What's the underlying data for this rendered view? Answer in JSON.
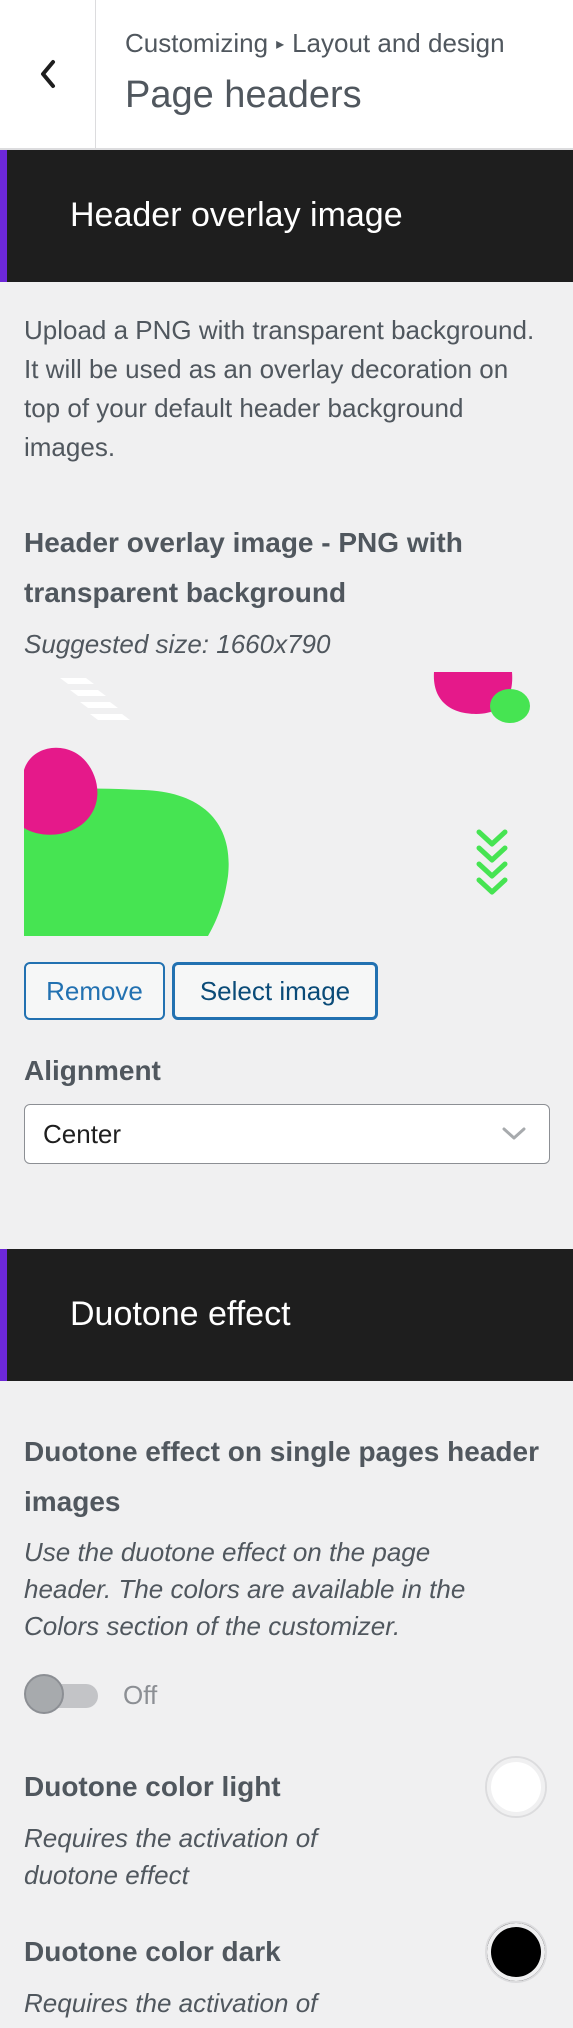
{
  "header": {
    "breadcrumb_root": "Customizing",
    "breadcrumb_sep": "▸",
    "breadcrumb_section": "Layout and design",
    "title": "Page headers"
  },
  "overlay_section": {
    "title": "Header overlay image",
    "description": "Upload a PNG with transparent background. It will be used as an overlay decoration on top of your default header background images.",
    "control_title": "Header overlay image - PNG with transparent background",
    "suggested_size": "Suggested size: 1660x790",
    "remove_label": "Remove",
    "select_label": "Select image",
    "alignment_label": "Alignment",
    "alignment_value": "Center"
  },
  "duotone_section": {
    "title": "Duotone effect",
    "control_title": "Duotone effect on single pages header images",
    "description": "Use the duotone effect on the page header. The colors are available in the Colors section of the customizer.",
    "toggle_label": "Off",
    "light_title": "Duotone color light",
    "light_note": "Requires the activation of duotone effect",
    "dark_title": "Duotone color dark",
    "dark_note": "Requires the activation of"
  },
  "colors": {
    "accent": "#6d28d9",
    "pink": "#e5198a",
    "green": "#46e452",
    "swatch_light": "#ffffff",
    "swatch_dark": "#000000"
  }
}
